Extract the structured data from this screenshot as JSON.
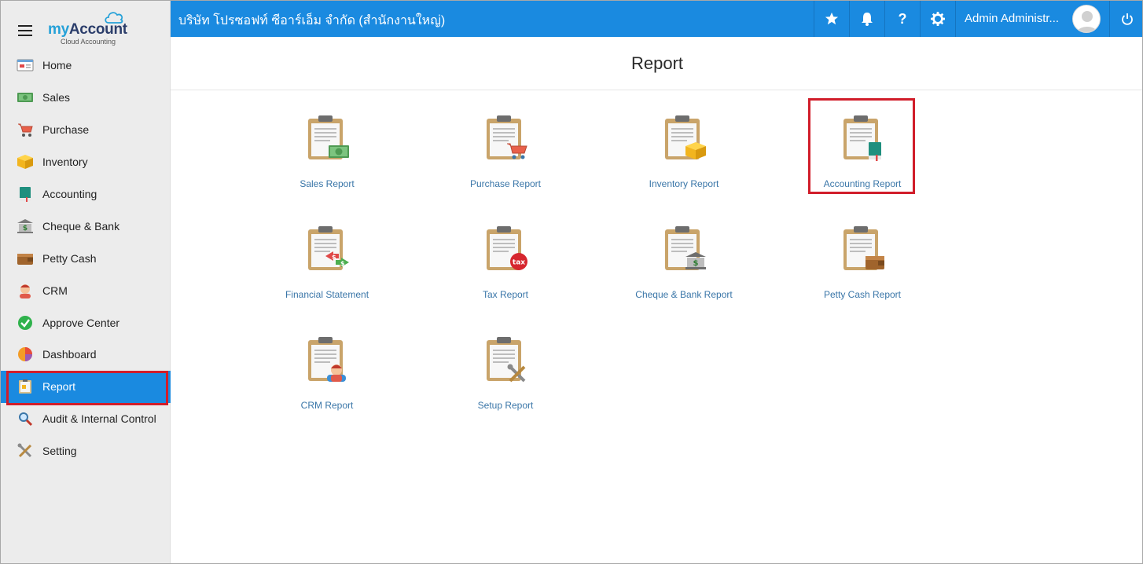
{
  "brand": {
    "my": "my",
    "account": "Account",
    "subtitle": "Cloud Accounting"
  },
  "topbar": {
    "company": "บริษัท โปรซอฟท์ ซีอาร์เอ็ม จำกัด (สำนักงานใหญ่)",
    "user_name": "Admin Administr...",
    "help_label": "?"
  },
  "sidebar": {
    "items": [
      {
        "label": "Home",
        "icon": "home-icon"
      },
      {
        "label": "Sales",
        "icon": "money-icon"
      },
      {
        "label": "Purchase",
        "icon": "cart-icon"
      },
      {
        "label": "Inventory",
        "icon": "box-icon"
      },
      {
        "label": "Accounting",
        "icon": "book-icon"
      },
      {
        "label": "Cheque & Bank",
        "icon": "bank-icon"
      },
      {
        "label": "Petty Cash",
        "icon": "wallet-icon"
      },
      {
        "label": "CRM",
        "icon": "person-icon"
      },
      {
        "label": "Approve Center",
        "icon": "check-icon"
      },
      {
        "label": "Dashboard",
        "icon": "pie-icon"
      },
      {
        "label": "Report",
        "icon": "report-icon",
        "active": true
      },
      {
        "label": "Audit & Internal Control",
        "icon": "magnifier-icon"
      },
      {
        "label": "Setting",
        "icon": "tools-icon"
      }
    ]
  },
  "main": {
    "title": "Report",
    "tiles": [
      {
        "label": "Sales Report",
        "icon": "sales-report-icon"
      },
      {
        "label": "Purchase Report",
        "icon": "purchase-report-icon"
      },
      {
        "label": "Inventory Report",
        "icon": "inventory-report-icon"
      },
      {
        "label": "Accounting Report",
        "icon": "accounting-report-icon",
        "highlighted": true
      },
      {
        "label": "Financial Statement",
        "icon": "financial-statement-icon"
      },
      {
        "label": "Tax Report",
        "icon": "tax-report-icon"
      },
      {
        "label": "Cheque & Bank Report",
        "icon": "cheque-bank-report-icon"
      },
      {
        "label": "Petty Cash Report",
        "icon": "petty-cash-report-icon"
      },
      {
        "label": "CRM Report",
        "icon": "crm-report-icon"
      },
      {
        "label": "Setup Report",
        "icon": "setup-report-icon"
      }
    ],
    "tax_badge": "tax",
    "dollar": "$"
  },
  "colors": {
    "topbar": "#1a8ae0",
    "sidebar": "#ececec",
    "highlight": "#d11d2a",
    "tile_label": "#3a76a8"
  }
}
